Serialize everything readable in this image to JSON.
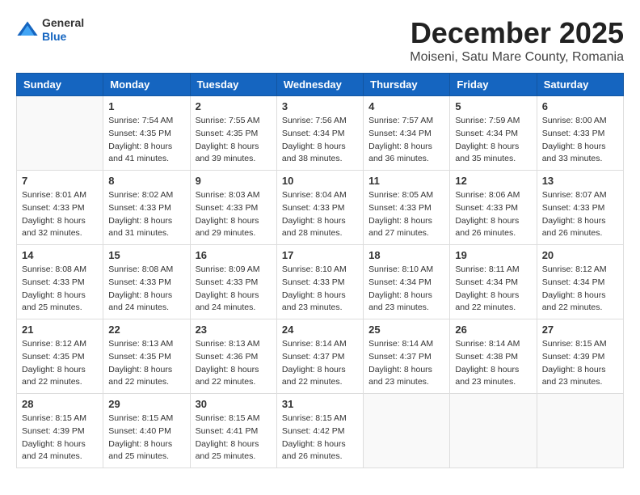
{
  "header": {
    "logo_general": "General",
    "logo_blue": "Blue",
    "month_title": "December 2025",
    "location": "Moiseni, Satu Mare County, Romania"
  },
  "days_of_week": [
    "Sunday",
    "Monday",
    "Tuesday",
    "Wednesday",
    "Thursday",
    "Friday",
    "Saturday"
  ],
  "weeks": [
    [
      {
        "day": "",
        "info": ""
      },
      {
        "day": "1",
        "info": "Sunrise: 7:54 AM\nSunset: 4:35 PM\nDaylight: 8 hours\nand 41 minutes."
      },
      {
        "day": "2",
        "info": "Sunrise: 7:55 AM\nSunset: 4:35 PM\nDaylight: 8 hours\nand 39 minutes."
      },
      {
        "day": "3",
        "info": "Sunrise: 7:56 AM\nSunset: 4:34 PM\nDaylight: 8 hours\nand 38 minutes."
      },
      {
        "day": "4",
        "info": "Sunrise: 7:57 AM\nSunset: 4:34 PM\nDaylight: 8 hours\nand 36 minutes."
      },
      {
        "day": "5",
        "info": "Sunrise: 7:59 AM\nSunset: 4:34 PM\nDaylight: 8 hours\nand 35 minutes."
      },
      {
        "day": "6",
        "info": "Sunrise: 8:00 AM\nSunset: 4:33 PM\nDaylight: 8 hours\nand 33 minutes."
      }
    ],
    [
      {
        "day": "7",
        "info": "Sunrise: 8:01 AM\nSunset: 4:33 PM\nDaylight: 8 hours\nand 32 minutes."
      },
      {
        "day": "8",
        "info": "Sunrise: 8:02 AM\nSunset: 4:33 PM\nDaylight: 8 hours\nand 31 minutes."
      },
      {
        "day": "9",
        "info": "Sunrise: 8:03 AM\nSunset: 4:33 PM\nDaylight: 8 hours\nand 29 minutes."
      },
      {
        "day": "10",
        "info": "Sunrise: 8:04 AM\nSunset: 4:33 PM\nDaylight: 8 hours\nand 28 minutes."
      },
      {
        "day": "11",
        "info": "Sunrise: 8:05 AM\nSunset: 4:33 PM\nDaylight: 8 hours\nand 27 minutes."
      },
      {
        "day": "12",
        "info": "Sunrise: 8:06 AM\nSunset: 4:33 PM\nDaylight: 8 hours\nand 26 minutes."
      },
      {
        "day": "13",
        "info": "Sunrise: 8:07 AM\nSunset: 4:33 PM\nDaylight: 8 hours\nand 26 minutes."
      }
    ],
    [
      {
        "day": "14",
        "info": "Sunrise: 8:08 AM\nSunset: 4:33 PM\nDaylight: 8 hours\nand 25 minutes."
      },
      {
        "day": "15",
        "info": "Sunrise: 8:08 AM\nSunset: 4:33 PM\nDaylight: 8 hours\nand 24 minutes."
      },
      {
        "day": "16",
        "info": "Sunrise: 8:09 AM\nSunset: 4:33 PM\nDaylight: 8 hours\nand 24 minutes."
      },
      {
        "day": "17",
        "info": "Sunrise: 8:10 AM\nSunset: 4:33 PM\nDaylight: 8 hours\nand 23 minutes."
      },
      {
        "day": "18",
        "info": "Sunrise: 8:10 AM\nSunset: 4:34 PM\nDaylight: 8 hours\nand 23 minutes."
      },
      {
        "day": "19",
        "info": "Sunrise: 8:11 AM\nSunset: 4:34 PM\nDaylight: 8 hours\nand 22 minutes."
      },
      {
        "day": "20",
        "info": "Sunrise: 8:12 AM\nSunset: 4:34 PM\nDaylight: 8 hours\nand 22 minutes."
      }
    ],
    [
      {
        "day": "21",
        "info": "Sunrise: 8:12 AM\nSunset: 4:35 PM\nDaylight: 8 hours\nand 22 minutes."
      },
      {
        "day": "22",
        "info": "Sunrise: 8:13 AM\nSunset: 4:35 PM\nDaylight: 8 hours\nand 22 minutes."
      },
      {
        "day": "23",
        "info": "Sunrise: 8:13 AM\nSunset: 4:36 PM\nDaylight: 8 hours\nand 22 minutes."
      },
      {
        "day": "24",
        "info": "Sunrise: 8:14 AM\nSunset: 4:37 PM\nDaylight: 8 hours\nand 22 minutes."
      },
      {
        "day": "25",
        "info": "Sunrise: 8:14 AM\nSunset: 4:37 PM\nDaylight: 8 hours\nand 23 minutes."
      },
      {
        "day": "26",
        "info": "Sunrise: 8:14 AM\nSunset: 4:38 PM\nDaylight: 8 hours\nand 23 minutes."
      },
      {
        "day": "27",
        "info": "Sunrise: 8:15 AM\nSunset: 4:39 PM\nDaylight: 8 hours\nand 23 minutes."
      }
    ],
    [
      {
        "day": "28",
        "info": "Sunrise: 8:15 AM\nSunset: 4:39 PM\nDaylight: 8 hours\nand 24 minutes."
      },
      {
        "day": "29",
        "info": "Sunrise: 8:15 AM\nSunset: 4:40 PM\nDaylight: 8 hours\nand 25 minutes."
      },
      {
        "day": "30",
        "info": "Sunrise: 8:15 AM\nSunset: 4:41 PM\nDaylight: 8 hours\nand 25 minutes."
      },
      {
        "day": "31",
        "info": "Sunrise: 8:15 AM\nSunset: 4:42 PM\nDaylight: 8 hours\nand 26 minutes."
      },
      {
        "day": "",
        "info": ""
      },
      {
        "day": "",
        "info": ""
      },
      {
        "day": "",
        "info": ""
      }
    ]
  ]
}
